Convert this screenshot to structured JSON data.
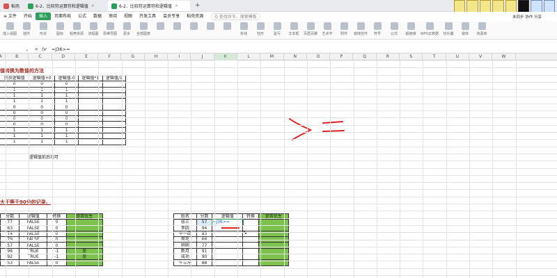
{
  "tabs": [
    {
      "label": "稻壳",
      "color": "#d9534f",
      "active": false
    },
    {
      "label": "6-2、比较符运算符和逻辑值",
      "color": "#2e9e5b",
      "active": false
    },
    {
      "label": "6-2、比较符运算符和逻辑值",
      "color": "#2e9e5b",
      "active": true
    }
  ],
  "menu": {
    "items": [
      "≡ 文件",
      "开始",
      "插入",
      "页面布局",
      "公式",
      "数据",
      "审阅",
      "视图",
      "开发工具",
      "会员专享",
      "稻壳资源"
    ],
    "active_index": 2,
    "search_placeholder": "Q 查找命令、搜索模板"
  },
  "ribbon": {
    "buttons": [
      "插入视图",
      "插件",
      "形状",
      "图标",
      "稻壳资源",
      "流程图",
      "思维导图",
      "更多",
      "全部图表",
      "",
      "",
      "",
      "",
      "",
      "折线",
      "柱形",
      "盈亏",
      "文本框",
      "页眉页脚",
      "艺术字",
      "附件",
      "窗体控件",
      "符号",
      "公式",
      "超链接",
      "WPS云数据",
      "切片器",
      "窗体",
      "资源夹"
    ]
  },
  "user": {
    "label": "未同步 协作 分享"
  },
  "formula_bar": {
    "icons": [
      "⌄",
      "✕",
      "✓"
    ],
    "fx": "fx",
    "content": "=J36>="
  },
  "columns": [
    "A",
    "B",
    "C",
    "D",
    "E",
    "F",
    "G",
    "H",
    "I",
    "J",
    "K",
    "L",
    "M",
    "N",
    "O",
    "P",
    "Q",
    "R",
    "S",
    "T",
    "U",
    "V",
    "W"
  ],
  "selected_column": "K",
  "section1": {
    "heading": "值转换为数值的方法",
    "headers": [
      "员员逻辑值",
      "逻辑值+0",
      "逻辑值-0",
      "逻辑值*1",
      "逻辑值/1"
    ],
    "rows": [
      [
        "0",
        "0",
        "0",
        "",
        ""
      ],
      [
        "1",
        "1",
        "1",
        "",
        ""
      ],
      [
        "1",
        "1",
        "1",
        "",
        ""
      ],
      [
        "1",
        "1",
        "1",
        "",
        ""
      ],
      [
        "0",
        "0",
        "0",
        "",
        ""
      ],
      [
        "0",
        "0",
        "0",
        "",
        ""
      ],
      [
        "0",
        "0",
        "0",
        "",
        ""
      ],
      [
        "0",
        "0",
        "0",
        "",
        ""
      ],
      [
        "1",
        "1",
        "1",
        "",
        ""
      ],
      [
        "1",
        "1",
        "1",
        "",
        ""
      ],
      [
        "1",
        "1",
        "1",
        "",
        ""
      ]
    ],
    "note": "逻辑值前后均可"
  },
  "section2": {
    "heading": "大于等于90分的记录。",
    "left_table": {
      "headers": [
        "分数",
        "逻辑值",
        "转换",
        "是否优生"
      ],
      "rows": [
        [
          "77",
          "FALSE",
          "0",
          ""
        ],
        [
          "63",
          "FALSE",
          "0",
          ""
        ],
        [
          "74",
          "FALSE",
          "0",
          ""
        ],
        [
          "79",
          "FALSE",
          "0",
          ""
        ],
        [
          "57",
          "FALSE",
          "0",
          ""
        ],
        [
          "96",
          "TRUE",
          "-1",
          "是"
        ],
        [
          "92",
          "TRUE",
          "-1",
          "是"
        ],
        [
          "53",
          "FALSE",
          "0",
          ""
        ]
      ]
    },
    "right_table": {
      "headers": [
        "姓名",
        "分数",
        "逻辑值",
        "转换",
        "是否优生"
      ],
      "rows": [
        [
          "张三",
          "57",
          "=J36>=",
          "",
          ""
        ],
        [
          "李四",
          "94",
          "",
          "",
          ""
        ],
        [
          "十一郎",
          "83",
          "",
          "",
          ""
        ],
        [
          "周花",
          "66",
          "",
          "",
          ""
        ],
        [
          "明明",
          "77",
          "",
          "",
          ""
        ],
        [
          "新月",
          "91",
          "",
          "",
          ""
        ],
        [
          "成功",
          "90",
          "",
          "",
          ""
        ],
        [
          "牛三斤",
          "88",
          "",
          "",
          ""
        ]
      ]
    }
  },
  "annotation": {
    "text": "> ="
  },
  "colors": {
    "accent": "#2e9e5b",
    "green_fill": "#7cc24c",
    "heading": "#a0281e",
    "annotation": "#e02020"
  }
}
